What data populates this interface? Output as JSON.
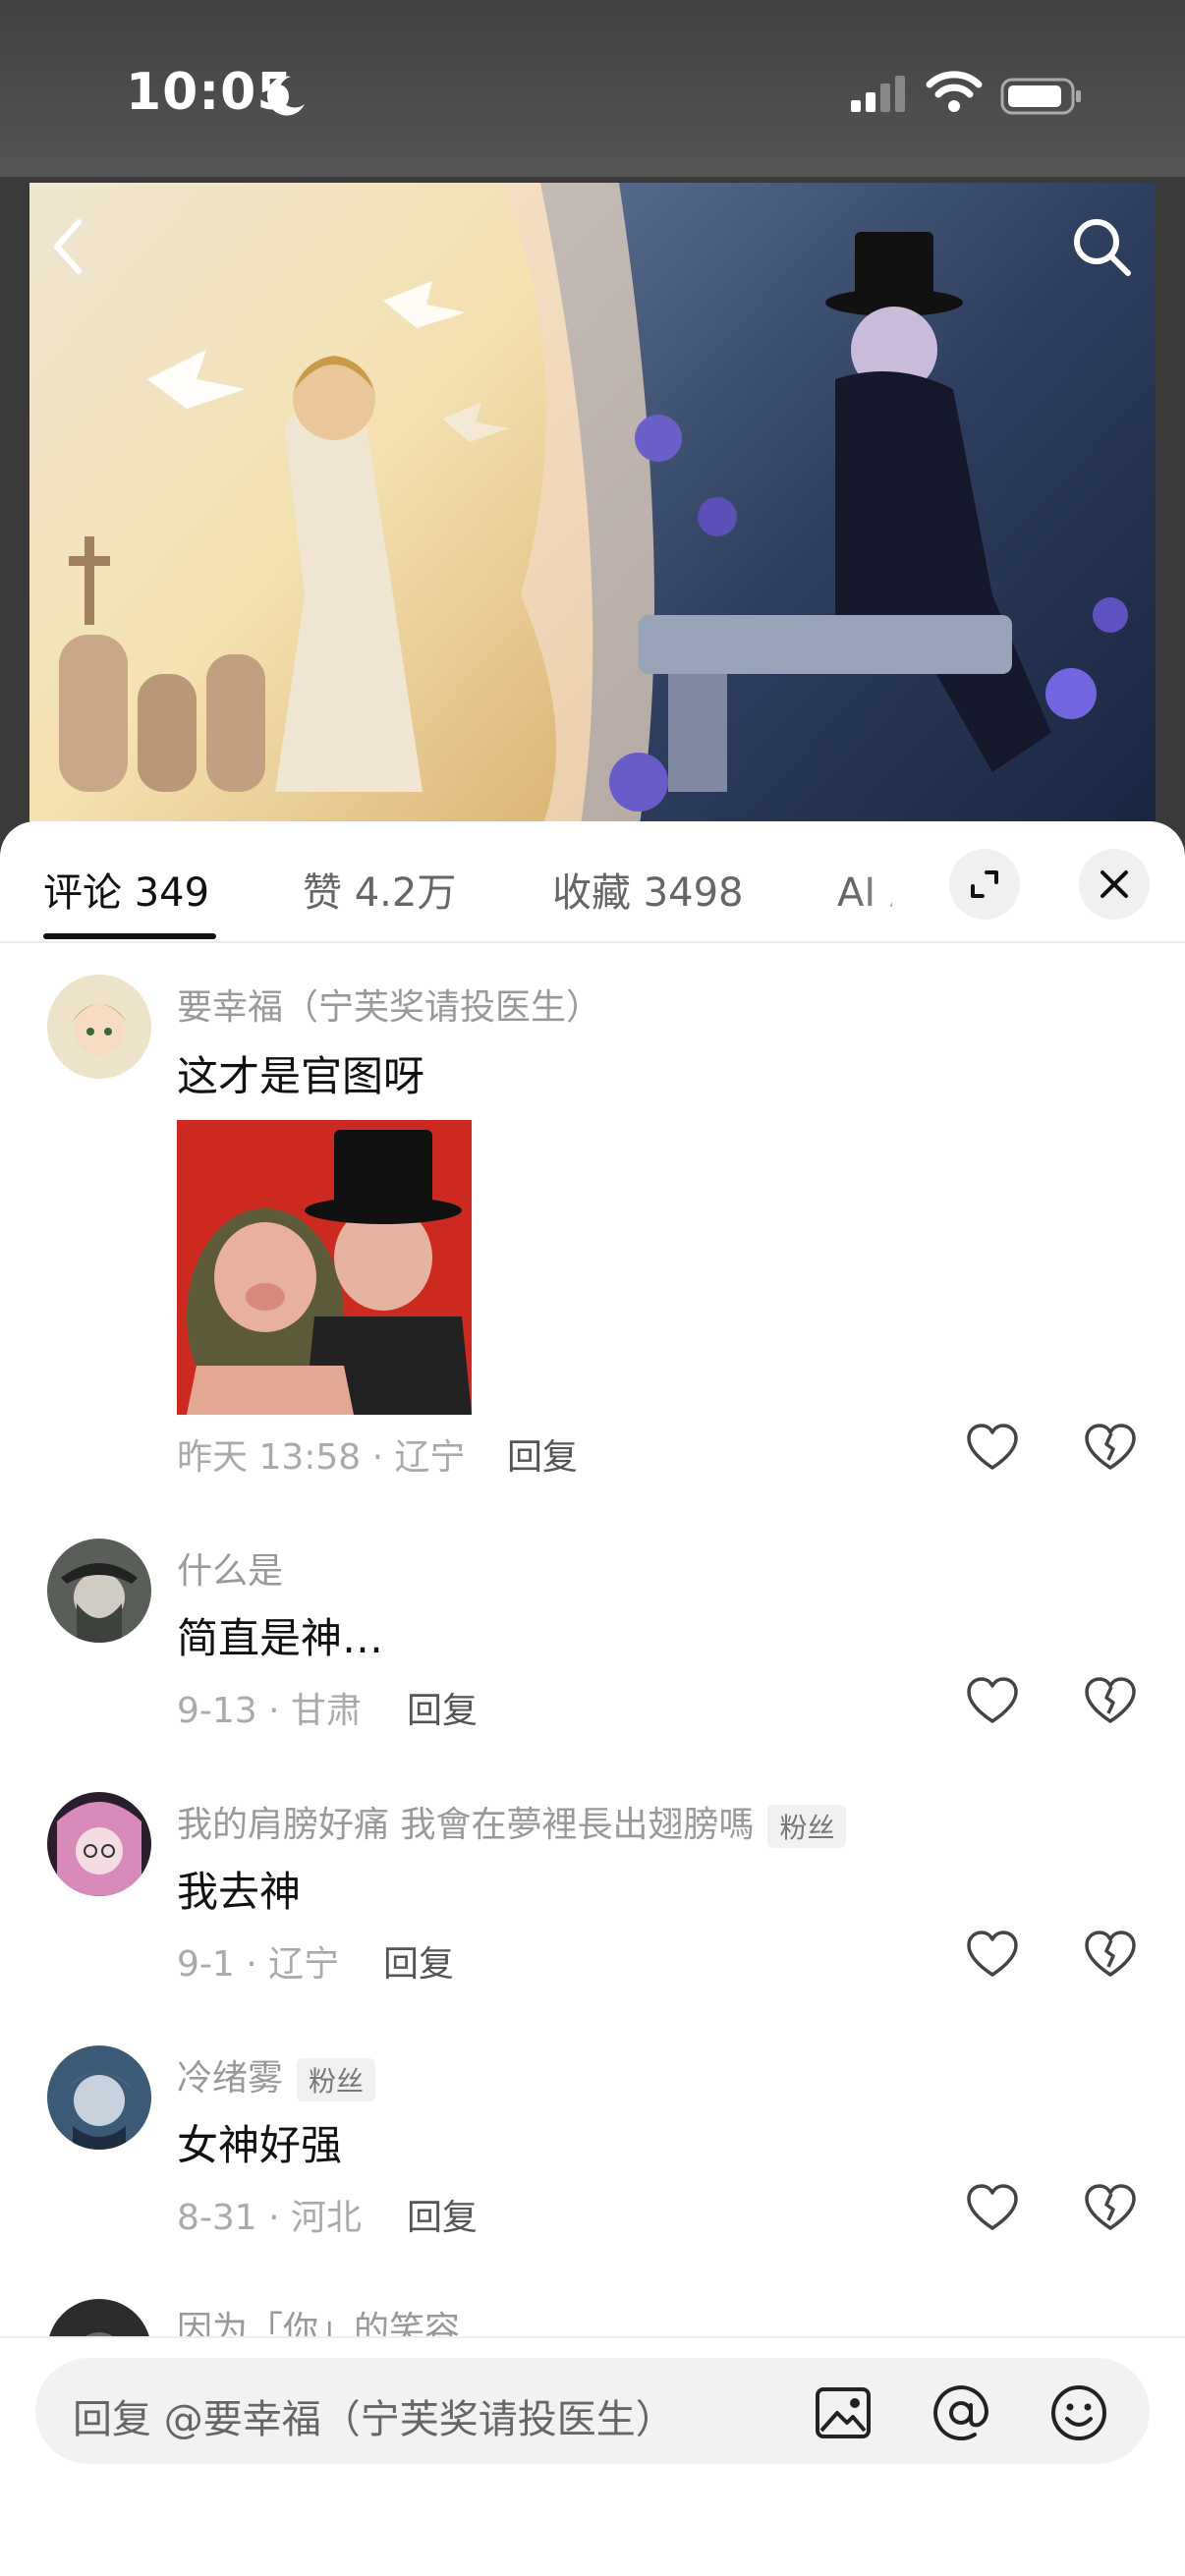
{
  "status": {
    "time": "10:05"
  },
  "tabs": [
    {
      "label": "评论 349"
    },
    {
      "label": "赞 4.2万"
    },
    {
      "label": "收藏 3498"
    },
    {
      "label": "AI 总"
    }
  ],
  "comments": [
    {
      "user": "要幸福（宁芙奖请投医生）",
      "text": "这才是官图呀",
      "meta": "昨天 13:58 · 辽宁",
      "reply": "回复"
    },
    {
      "user": "什么是",
      "text": "简直是神…",
      "meta": "9-13 · 甘肃",
      "reply": "回复"
    },
    {
      "user": "我的肩膀好痛 我會在夢裡長出翅膀嗎",
      "badge": "粉丝",
      "text": "我去神",
      "meta": "9-1 · 辽宁",
      "reply": "回复"
    },
    {
      "user": "冷绪雾",
      "badge": "粉丝",
      "text": "女神好强",
      "meta": "8-31 · 河北",
      "reply": "回复"
    },
    {
      "user": "因为「你」的笑容"
    }
  ],
  "input": {
    "placeholder": "回复 @要幸福（宁芙奖请投医生）"
  },
  "colors": {
    "accent": "#111111",
    "muted": "#999999",
    "sheet": "#ffffff",
    "status_bar": "#444444"
  }
}
